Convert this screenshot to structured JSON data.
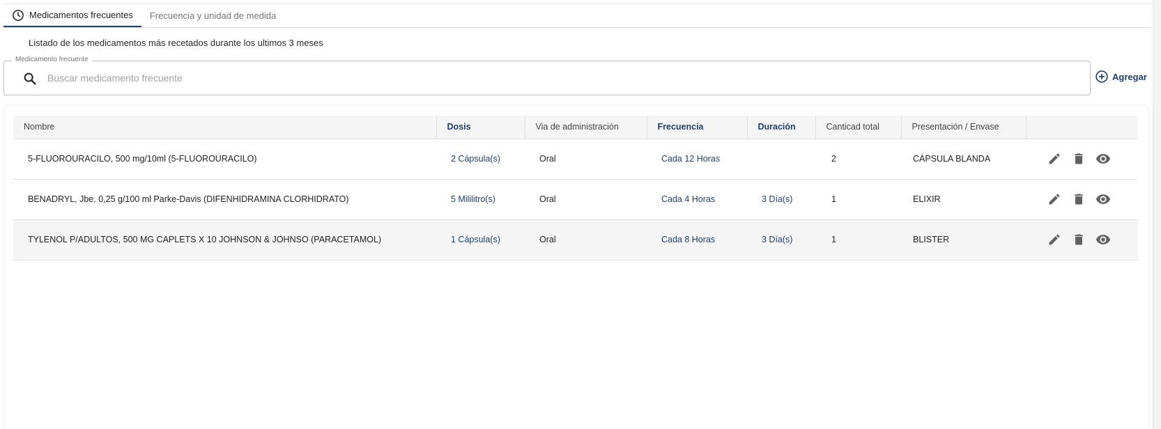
{
  "tabs": [
    {
      "label": "Medicamentos frecuentes",
      "active": true
    },
    {
      "label": "Frecuencia y unidad de medida",
      "active": false
    }
  ],
  "subtitle": "Listado de los medicamentos más recetados durante los ultimos 3 meses",
  "search": {
    "legend": "Medicamento frecuente",
    "placeholder": "Buscar medicamento frecuente",
    "value": ""
  },
  "add_button": {
    "label": "Agregar"
  },
  "table": {
    "columns": [
      "Nombre",
      "Dosis",
      "Via de administración",
      "Frecuencia",
      "Duración",
      "Canticad total",
      "Presentación / Envase",
      ""
    ],
    "rows": [
      {
        "nombre": "5-FLUOROURACILO, 500 mg/10ml (5-FLUOROURACILO)",
        "dosis": "2 Cápsula(s)",
        "via": "Oral",
        "frecuencia": "Cada 12 Horas",
        "duracion": "",
        "cantidad": "2",
        "presentacion": "CÁPSULA BLANDA"
      },
      {
        "nombre": "BENADRYL, Jbe. 0,25 g/100 ml Parke-Davis (DIFENHIDRAMINA CLORHIDRATO)",
        "dosis": "5 Mililitro(s)",
        "via": "Oral",
        "frecuencia": "Cada 4 Horas",
        "duracion": "3 Día(s)",
        "cantidad": "1",
        "presentacion": "ELIXIR"
      },
      {
        "nombre": "TYLENOL P/ADULTOS, 500 MG CAPLETS X 10 JOHNSON & JOHNSO (PARACETAMOL)",
        "dosis": "1 Cápsula(s)",
        "via": "Oral",
        "frecuencia": "Cada 8 Horas",
        "duracion": "3 Día(s)",
        "cantidad": "1",
        "presentacion": "BLISTER"
      }
    ]
  },
  "colors": {
    "accent": "#1e3f6e",
    "icon": "#616161",
    "header_bg": "#f5f5f5"
  },
  "icons": {
    "tab": "clock-icon",
    "search": "search-icon",
    "add": "plus-circle-icon",
    "edit": "pencil-icon",
    "delete": "trash-icon",
    "view": "eye-icon"
  }
}
